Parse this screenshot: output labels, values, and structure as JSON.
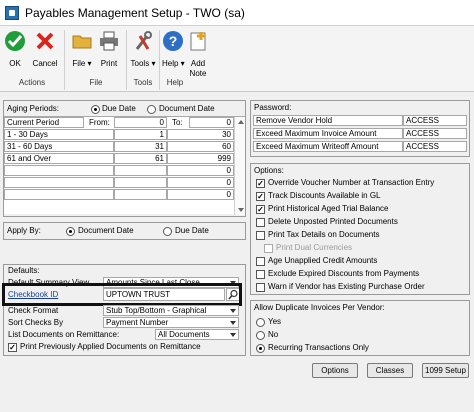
{
  "window": {
    "title": "Payables Management Setup  -  TWO (sa)"
  },
  "ribbon": {
    "ok": "OK",
    "cancel": "Cancel",
    "actions_group": "Actions",
    "file": "File",
    "print": "Print",
    "file_group": "File",
    "tools": "Tools",
    "tools_group": "Tools",
    "help": "Help",
    "add_note_1": "Add",
    "add_note_2": "Note",
    "help_group": "Help"
  },
  "aging": {
    "label": "Aging Periods:",
    "due_date": "Due Date",
    "document_date": "Document Date",
    "headers": {
      "period": "Current Period",
      "from": "From:",
      "to": "To:"
    },
    "rows": [
      {
        "name": "Current Period",
        "from": "0",
        "to": "0"
      },
      {
        "name": "1 - 30 Days",
        "from": "1",
        "to": "30"
      },
      {
        "name": "31 - 60 Days",
        "from": "31",
        "to": "60"
      },
      {
        "name": "61 and Over",
        "from": "61",
        "to": "999"
      },
      {
        "name": "",
        "from": "",
        "to": "0"
      },
      {
        "name": "",
        "from": "",
        "to": "0"
      },
      {
        "name": "",
        "from": "",
        "to": "0"
      }
    ]
  },
  "apply_by": {
    "label": "Apply By:",
    "document_date": "Document Date",
    "due_date": "Due Date"
  },
  "defaults": {
    "label": "Defaults:",
    "summary_view_label": "Default Summary View",
    "summary_view_value": "Amounts Since Last Close",
    "checkbook_label": "Checkbook ID",
    "checkbook_value": "UPTOWN TRUST",
    "check_format_label": "Check Format",
    "check_format_value": "Stub Top/Bottom - Graphical",
    "sort_checks_label": "Sort Checks By",
    "sort_checks_value": "Payment Number",
    "remittance_label": "List Documents on Remittance:",
    "remittance_value": "All Documents",
    "print_prev": "Print Previously Applied Documents on Remittance"
  },
  "password": {
    "label": "Password:",
    "rows": [
      {
        "name": "Remove Vendor Hold",
        "value": "ACCESS"
      },
      {
        "name": "Exceed Maximum Invoice Amount",
        "value": "ACCESS"
      },
      {
        "name": "Exceed Maximum Writeoff Amount",
        "value": "ACCESS"
      }
    ]
  },
  "options": {
    "label": "Options:",
    "items": [
      {
        "text": "Override Voucher Number at Transaction Entry",
        "checked": true
      },
      {
        "text": "Track Discounts  Available in GL",
        "checked": true
      },
      {
        "text": "Print Historical  Aged Trial Balance",
        "checked": true
      },
      {
        "text": "Delete Unposted Printed Documents",
        "checked": false
      },
      {
        "text": "Print Tax Details on Documents",
        "checked": false
      },
      {
        "text": "Print Dual Currencies",
        "checked": false
      },
      {
        "text": "Age Unapplied Credit Amounts",
        "checked": false
      },
      {
        "text": "Exclude Expired Discounts from Payments",
        "checked": false
      },
      {
        "text": "Warn if Vendor has Existing Purchase Order",
        "checked": false
      }
    ]
  },
  "duplicate": {
    "label": "Allow Duplicate Invoices Per Vendor:",
    "yes": "Yes",
    "no": "No",
    "recurring": "Recurring Transactions Only"
  },
  "buttons": {
    "options": "Options",
    "classes": "Classes",
    "setup_1099": "1099 Setup"
  }
}
